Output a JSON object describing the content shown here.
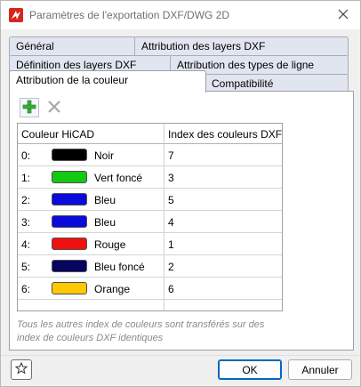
{
  "window": {
    "title": "Paramètres de l'exportation DXF/DWG 2D",
    "app_icon": "hicad-logo-icon",
    "close_icon": "close-icon"
  },
  "tabs": {
    "row1": [
      {
        "label": "Général"
      },
      {
        "label": "Attribution des layers DXF"
      }
    ],
    "row2": [
      {
        "label": "Définition des layers DXF"
      },
      {
        "label": "Attribution des types de ligne"
      }
    ],
    "row3": [
      {
        "label": "Attribution de la couleur",
        "active": true
      },
      {
        "label": "Compatibilité"
      }
    ]
  },
  "toolbar": {
    "add_icon": "plus-icon",
    "delete_icon": "delete-x-icon"
  },
  "table": {
    "headers": [
      "Couleur HiCAD",
      "Index des couleurs DXF"
    ],
    "rows": [
      {
        "index": "0:",
        "color": "#000000",
        "name": "Noir",
        "dxf": "7"
      },
      {
        "index": "1:",
        "color": "#14c814",
        "name": "Vert foncé",
        "dxf": "3"
      },
      {
        "index": "2:",
        "color": "#0a0adc",
        "name": "Bleu",
        "dxf": "5"
      },
      {
        "index": "3:",
        "color": "#0a0adc",
        "name": "Bleu",
        "dxf": "4"
      },
      {
        "index": "4:",
        "color": "#f01010",
        "name": "Rouge",
        "dxf": "1"
      },
      {
        "index": "5:",
        "color": "#050560",
        "name": "Bleu foncé",
        "dxf": "2"
      },
      {
        "index": "6:",
        "color": "#ffc800",
        "name": "Orange",
        "dxf": "6"
      }
    ]
  },
  "note": "Tous les autres index de couleurs sont transférés sur des index de couleurs DXF identiques",
  "footer": {
    "favorite_icon": "star-icon",
    "ok_label": "OK",
    "cancel_label": "Annuler"
  }
}
